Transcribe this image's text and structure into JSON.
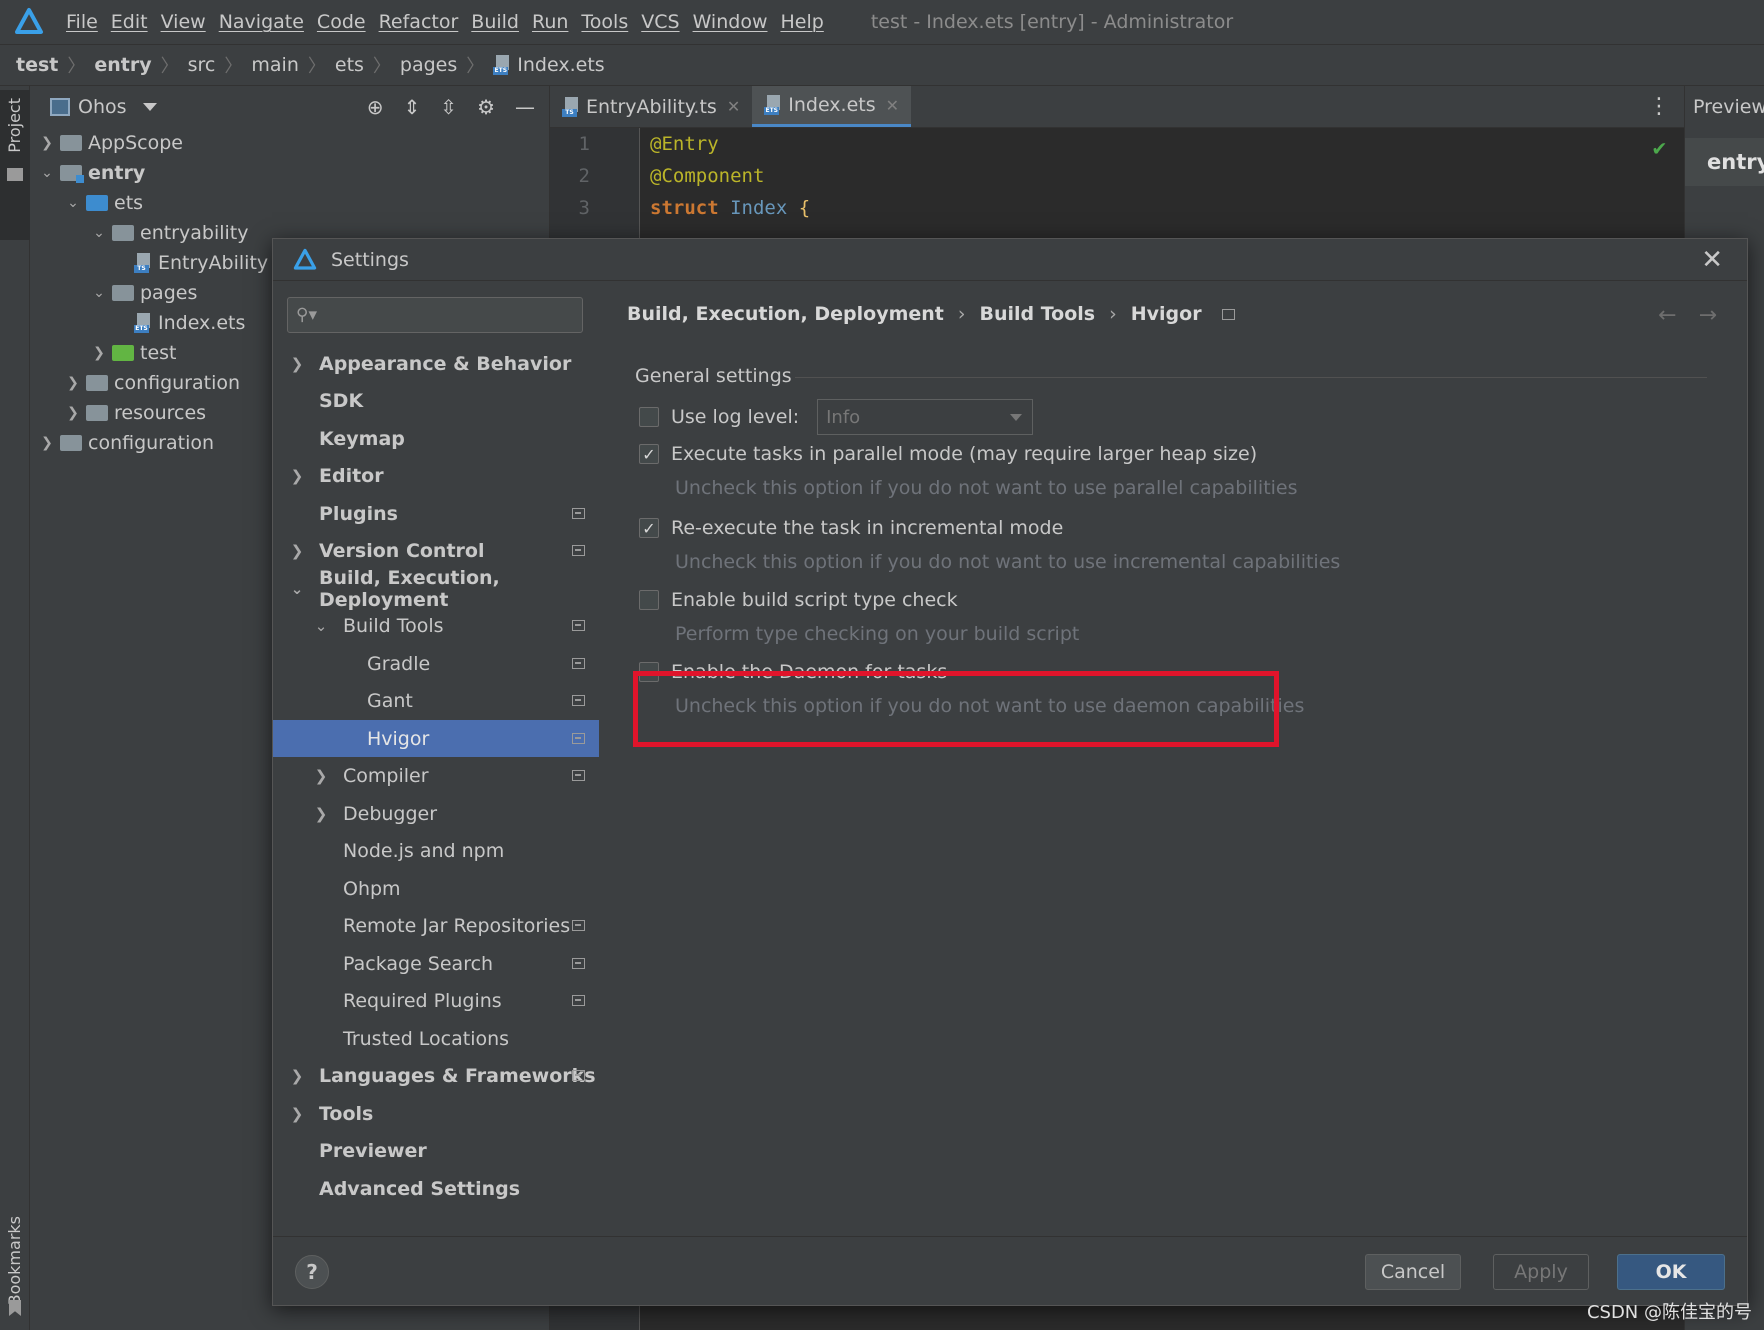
{
  "window": {
    "title": "test - Index.ets [entry] - Administrator",
    "menu": [
      "File",
      "Edit",
      "View",
      "Navigate",
      "Code",
      "Refactor",
      "Build",
      "Run",
      "Tools",
      "VCS",
      "Window",
      "Help"
    ]
  },
  "breadcrumb": [
    "test",
    "entry",
    "src",
    "main",
    "ets",
    "pages",
    "Index.ets"
  ],
  "left_strip": {
    "project": "Project",
    "bookmarks": "Bookmarks"
  },
  "project_panel": {
    "view_label": "Ohos",
    "tree": [
      {
        "label": "AppScope"
      },
      {
        "label": "entry"
      },
      {
        "label": "ets"
      },
      {
        "label": "entryability"
      },
      {
        "label": "EntryAbility"
      },
      {
        "label": "pages"
      },
      {
        "label": "Index.ets"
      },
      {
        "label": "test"
      },
      {
        "label": "configuration"
      },
      {
        "label": "resources"
      },
      {
        "label": "configuration"
      }
    ]
  },
  "editor": {
    "tabs": [
      {
        "label": "EntryAbility.ts"
      },
      {
        "label": "Index.ets"
      }
    ],
    "lines": [
      {
        "n": "1",
        "a": "@Entry"
      },
      {
        "n": "2",
        "a": "@Component"
      },
      {
        "n": "3",
        "kw": "struct",
        "id": "Index",
        "brace": "{"
      }
    ]
  },
  "previewer": {
    "title": "Previewer",
    "entry": "entry :"
  },
  "settings": {
    "title": "Settings",
    "search_placeholder": "",
    "tree": {
      "appearance": "Appearance & Behavior",
      "sdk": "SDK",
      "keymap": "Keymap",
      "editor": "Editor",
      "plugins": "Plugins",
      "vcs": "Version Control",
      "bed": "Build, Execution, Deployment",
      "build_tools": "Build Tools",
      "gradle": "Gradle",
      "gant": "Gant",
      "hvigor": "Hvigor",
      "compiler": "Compiler",
      "debugger": "Debugger",
      "nodejs": "Node.js and npm",
      "ohpm": "Ohpm",
      "remote_jar": "Remote Jar Repositories",
      "package_search": "Package Search",
      "required_plugins": "Required Plugins",
      "trusted": "Trusted Locations",
      "languages": "Languages & Frameworks",
      "tools": "Tools",
      "previewer": "Previewer",
      "advanced": "Advanced Settings"
    },
    "breadcrumb": [
      "Build, Execution, Deployment",
      "Build Tools",
      "Hvigor"
    ],
    "group_title": "General settings",
    "options": {
      "log_level": {
        "label": "Use log level:",
        "checked": false,
        "value": "Info"
      },
      "parallel": {
        "label": "Execute tasks in parallel mode (may require larger heap size)",
        "checked": true,
        "hint": "Uncheck this option if you do not want to use parallel capabilities"
      },
      "incremental": {
        "label": "Re-execute the task in incremental mode",
        "checked": true,
        "hint": "Uncheck this option if you do not want to use incremental capabilities"
      },
      "typecheck": {
        "label": "Enable build script type check",
        "checked": false,
        "hint": "Perform type checking on your build script"
      },
      "daemon": {
        "label": "Enable the Daemon for tasks",
        "checked": false,
        "hint": "Uncheck this option if you do not want to use daemon capabilities"
      }
    },
    "buttons": {
      "help": "?",
      "cancel": "Cancel",
      "apply": "Apply",
      "ok": "OK"
    }
  },
  "watermark": "CSDN @陈佳宝的号",
  "colors": {
    "accent": "#4b6eaf",
    "highlight": "#e0142b",
    "primary_button": "#365880"
  }
}
